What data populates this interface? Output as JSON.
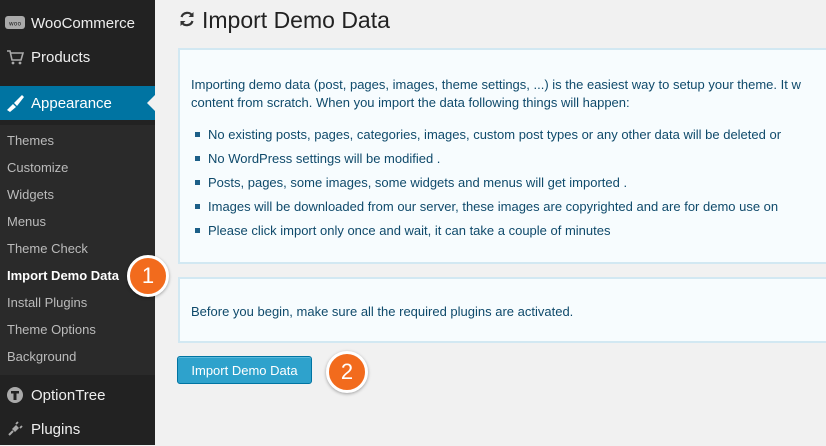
{
  "sidebar": {
    "top_items": [
      {
        "label": "WooCommerce",
        "icon": "woocommerce-icon"
      },
      {
        "label": "Products",
        "icon": "cart-icon"
      },
      {
        "label": "Appearance",
        "icon": "paintbrush-icon",
        "active": true
      },
      {
        "label": "OptionTree",
        "icon": "optiontree-icon"
      },
      {
        "label": "Plugins",
        "icon": "plug-icon"
      }
    ],
    "submenu": [
      {
        "label": "Themes"
      },
      {
        "label": "Customize"
      },
      {
        "label": "Widgets"
      },
      {
        "label": "Menus"
      },
      {
        "label": "Theme Check"
      },
      {
        "label": "Import Demo Data",
        "current": true
      },
      {
        "label": "Install Plugins"
      },
      {
        "label": "Theme Options"
      },
      {
        "label": "Background"
      }
    ]
  },
  "page": {
    "title": "Import Demo Data",
    "title_icon": "refresh-icon"
  },
  "notice": {
    "intro_line1": "Importing demo data (post, pages, images, theme settings, ...) is the easiest way to setup your theme. It w",
    "intro_line2": "content from scratch. When you import the data following things will happen:",
    "bullets": [
      "No existing posts, pages, categories, images, custom post types or any other data will be deleted or",
      "No WordPress settings will be modified .",
      "Posts, pages, some images, some widgets and menus will get imported .",
      "Images will be downloaded from our server, these images are copyrighted and are for demo use on",
      "Please click import only once and wait, it can take a couple of minutes"
    ]
  },
  "prerequisite": "Before you begin, make sure all the required plugins are activated.",
  "import_button": "Import Demo Data",
  "badges": [
    "1",
    "2"
  ],
  "colors": {
    "sidebar_bg": "#222222",
    "active_menu": "#0074a2",
    "button_bg": "#2ea2cc",
    "badge": "#f26b1d",
    "notice_text": "#0f4a6b"
  }
}
